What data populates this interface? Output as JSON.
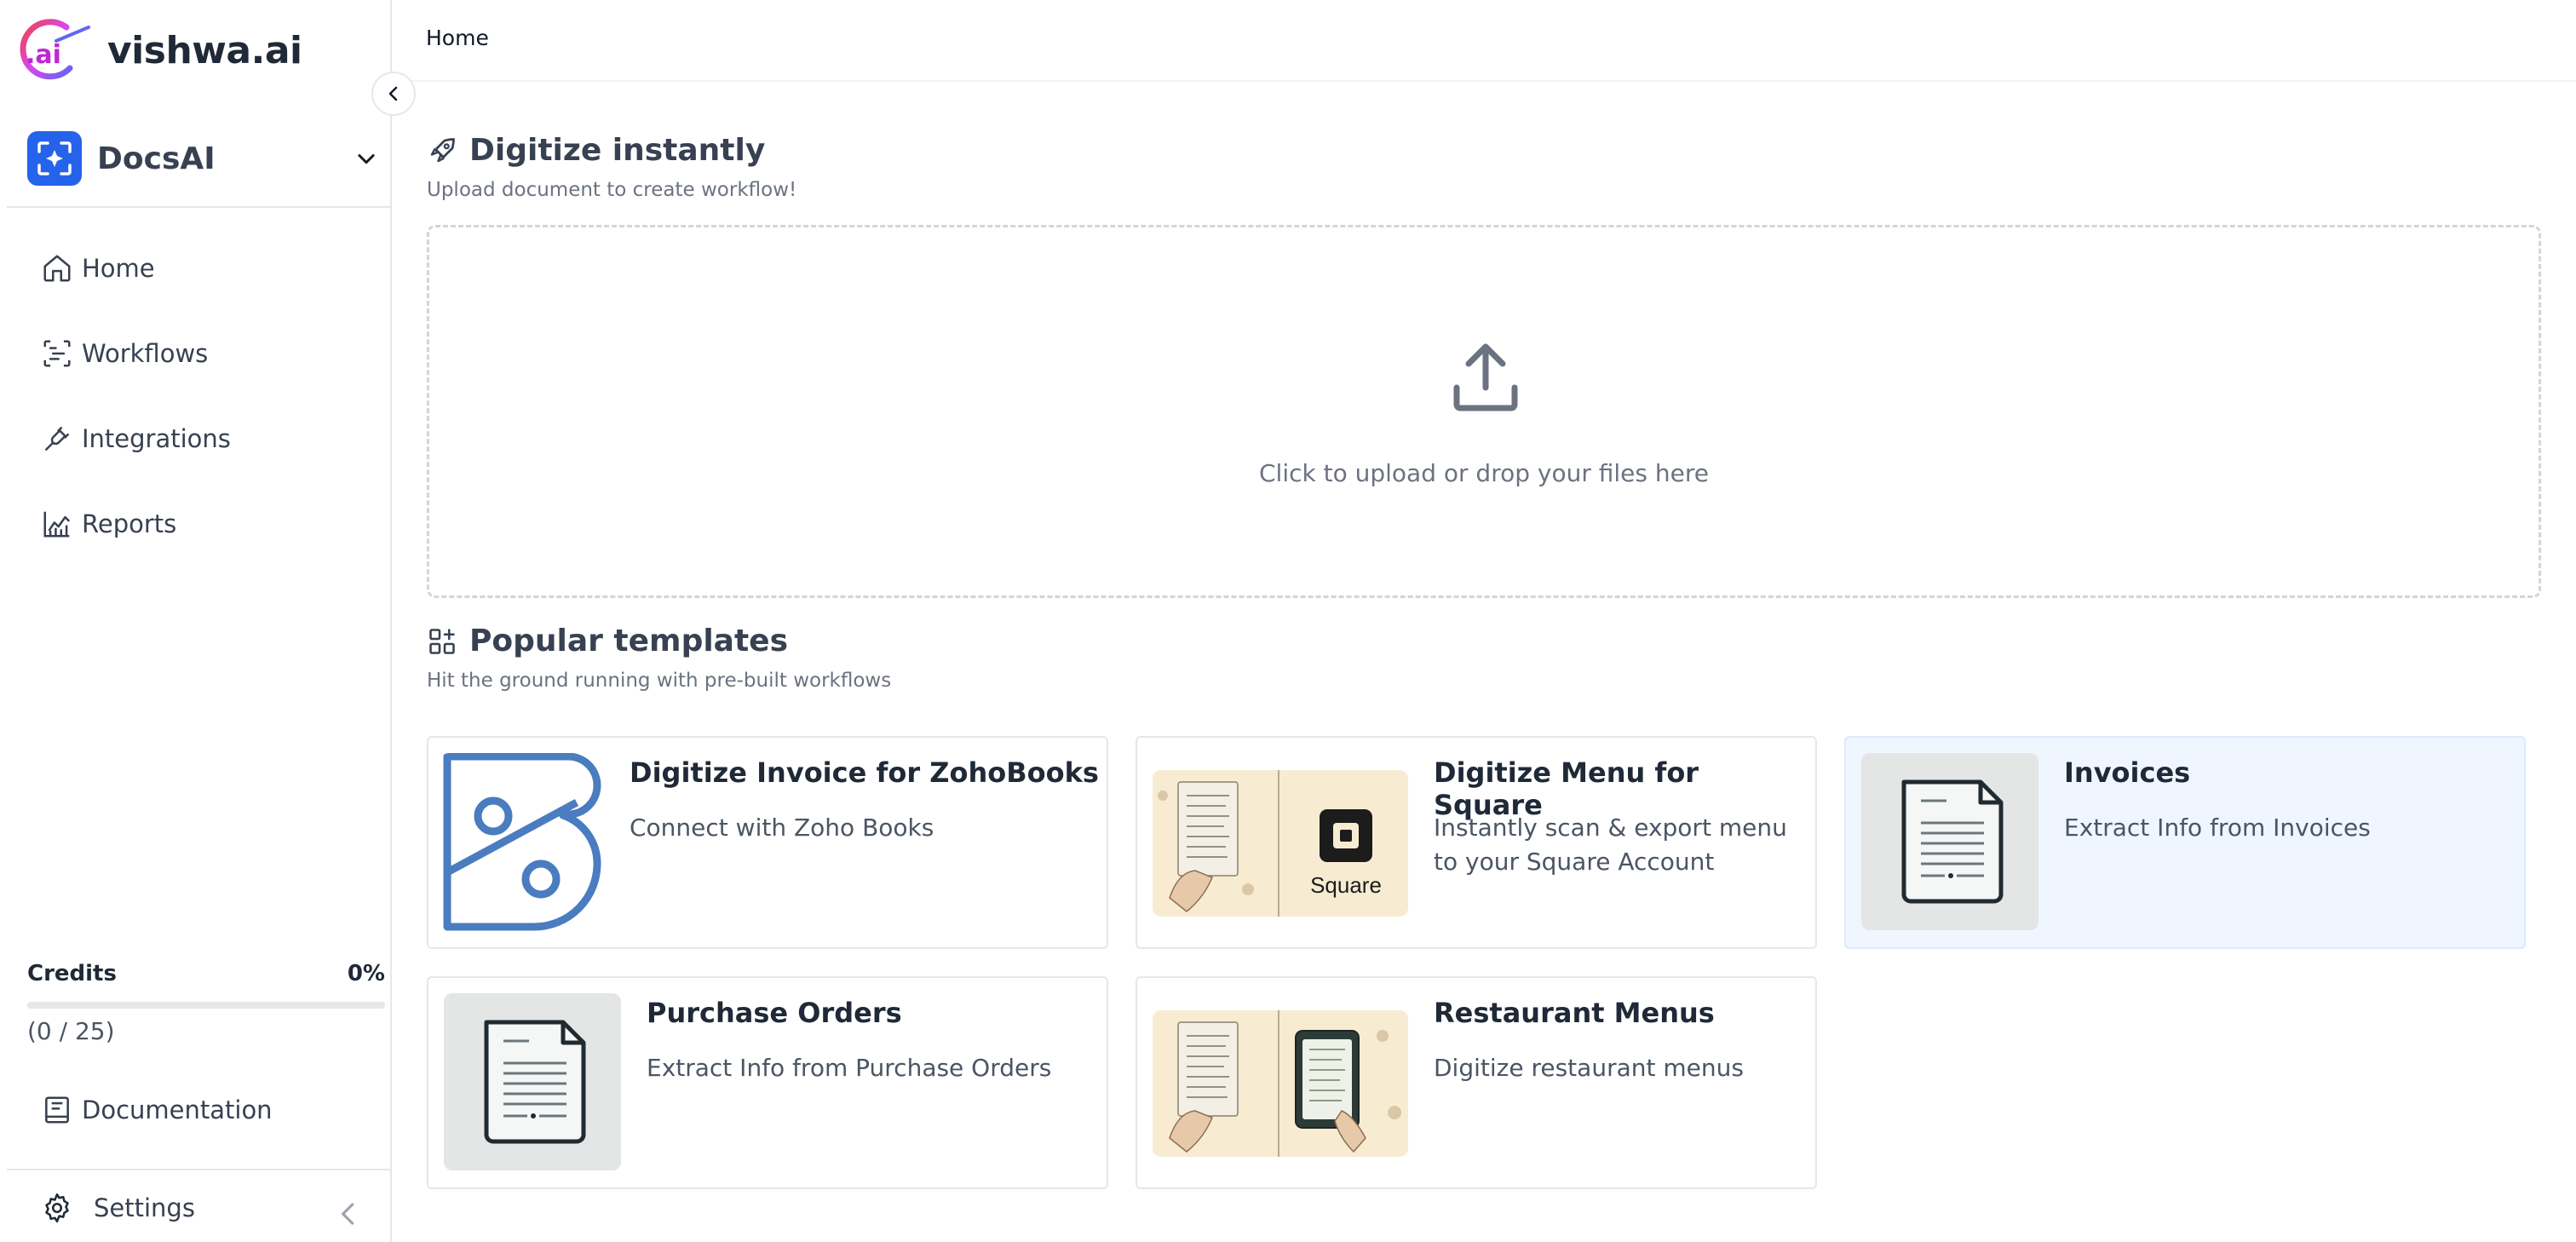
{
  "brand": {
    "name": "vishwa.ai",
    "logo_text": ".ai"
  },
  "workspace": {
    "name": "DocsAI"
  },
  "nav": [
    {
      "label": "Home",
      "icon": "home-icon"
    },
    {
      "label": "Workflows",
      "icon": "workflows-icon"
    },
    {
      "label": "Integrations",
      "icon": "plug-icon"
    },
    {
      "label": "Reports",
      "icon": "chart-icon"
    }
  ],
  "credits": {
    "label": "Credits",
    "percent_text": "0%",
    "count": "(0 / 25)",
    "used_fraction": 0
  },
  "documentation": {
    "label": "Documentation"
  },
  "settings": {
    "label": "Settings"
  },
  "breadcrumb": "Home",
  "digitize": {
    "title": "Digitize instantly",
    "subtitle": "Upload document to create workflow!",
    "upload_text": "Click to upload or drop your files here"
  },
  "templates": {
    "title": "Popular templates",
    "subtitle": "Hit the ground running with pre-built workflows",
    "items": [
      {
        "title": "Digitize Invoice for ZohoBooks",
        "desc": "Connect with Zoho Books"
      },
      {
        "title": "Digitize Menu for Square",
        "desc": "Instantly scan & export menu to your Square Account",
        "brand_text": "Square"
      },
      {
        "title": "Invoices",
        "desc": "Extract Info from Invoices"
      },
      {
        "title": "Purchase Orders",
        "desc": "Extract Info from Purchase Orders"
      },
      {
        "title": "Restaurant Menus",
        "desc": "Digitize restaurant menus"
      }
    ]
  },
  "colors": {
    "accent": "#2563eb",
    "zoho_blue": "#4a7cc0",
    "highlight_bg": "#eff6ff"
  }
}
